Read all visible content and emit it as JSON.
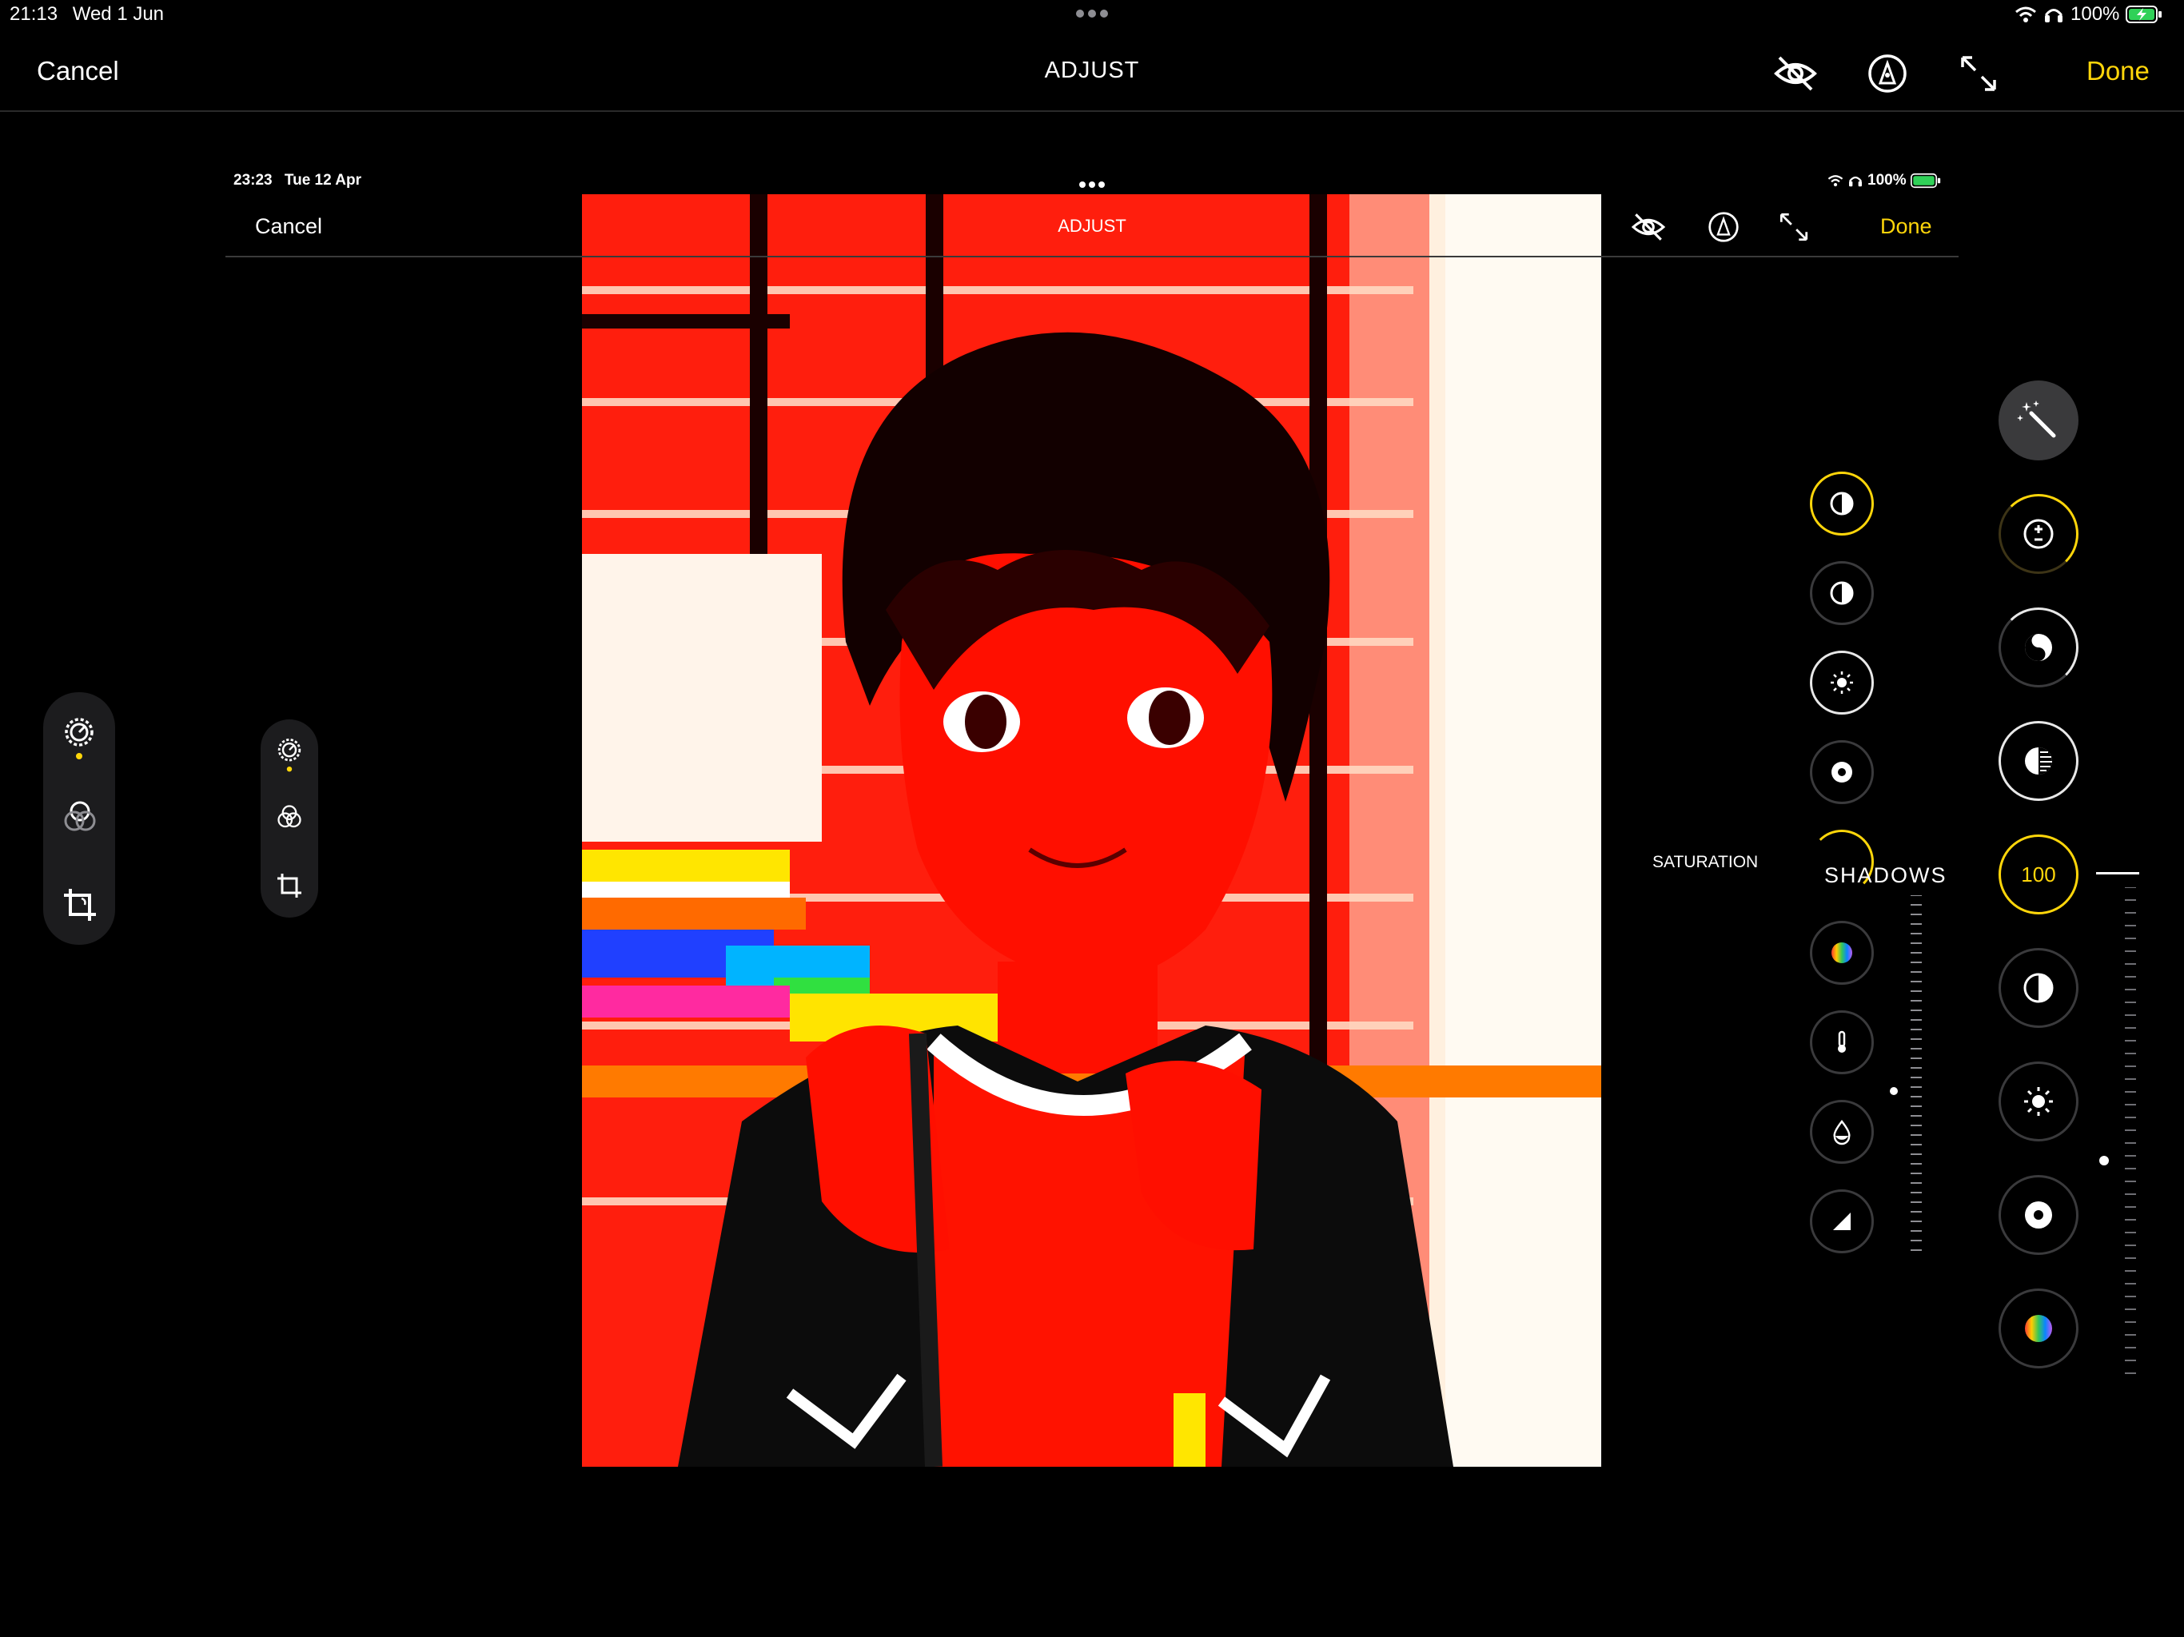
{
  "outer": {
    "status_time": "21:13",
    "status_date": "Wed 1 Jun",
    "battery": "100%",
    "cancel_label": "Cancel",
    "title": "ADJUST",
    "done_label": "Done"
  },
  "inner": {
    "status_time": "23:23",
    "status_date": "Tue 12 Apr",
    "battery": "100%",
    "cancel_label": "Cancel",
    "title": "ADJUST",
    "done_label": "Done",
    "adjust_label": "SATURATION",
    "shadows_label": "SHADOWS"
  },
  "outer_adjust": {
    "selected_value": "100"
  },
  "colors": {
    "accent": "#ffd60a",
    "background": "#000000",
    "panel": "#1c1c1e"
  },
  "icons": {
    "left_tools": [
      "adjust-dial-icon",
      "filters-icon",
      "crop-icon"
    ],
    "inner_adjust_tools": [
      "brilliance-icon",
      "contrast-icon",
      "brightness-icon",
      "black-point-icon",
      "saturation-icon",
      "vibrance-icon",
      "warmth-icon",
      "tint-icon",
      "sharpness-icon"
    ],
    "outer_adjust_tools": [
      "auto-magic-wand-icon",
      "exposure-icon",
      "brilliance-icon",
      "highlights-icon",
      "shadows-icon",
      "contrast-icon",
      "brightness-icon",
      "black-point-icon",
      "saturation-icon"
    ]
  }
}
